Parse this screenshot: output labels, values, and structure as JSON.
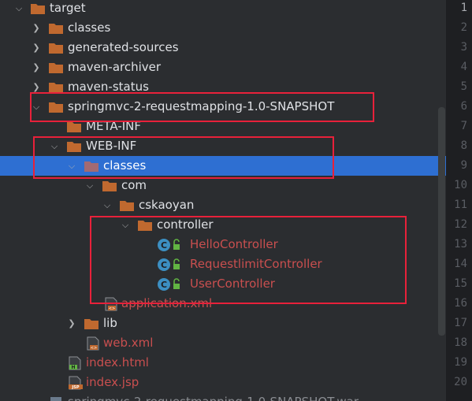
{
  "tree": {
    "items": [
      {
        "label": "target",
        "type": "folder",
        "expanded": true,
        "depth": 0
      },
      {
        "label": "classes",
        "type": "folder",
        "expanded": false,
        "depth": 1
      },
      {
        "label": "generated-sources",
        "type": "folder",
        "expanded": false,
        "depth": 1
      },
      {
        "label": "maven-archiver",
        "type": "folder",
        "expanded": false,
        "depth": 1
      },
      {
        "label": "maven-status",
        "type": "folder",
        "expanded": false,
        "depth": 1
      },
      {
        "label": "springmvc-2-requestmapping-1.0-SNAPSHOT",
        "type": "folder",
        "expanded": true,
        "depth": 1
      },
      {
        "label": "META-INF",
        "type": "folder",
        "expanded": null,
        "depth": 2
      },
      {
        "label": "WEB-INF",
        "type": "folder",
        "expanded": true,
        "depth": 2
      },
      {
        "label": "classes",
        "type": "folder",
        "expanded": true,
        "depth": 3,
        "selected": true
      },
      {
        "label": "com",
        "type": "folder",
        "expanded": true,
        "depth": 4
      },
      {
        "label": "cskaoyan",
        "type": "folder",
        "expanded": true,
        "depth": 5
      },
      {
        "label": "controller",
        "type": "folder",
        "expanded": true,
        "depth": 6
      },
      {
        "label": "HelloController",
        "type": "class",
        "depth": 7
      },
      {
        "label": "RequestlimitController",
        "type": "class",
        "depth": 7
      },
      {
        "label": "UserController",
        "type": "class",
        "depth": 7
      },
      {
        "label": "application.xml",
        "type": "xml",
        "depth": 4
      },
      {
        "label": "lib",
        "type": "folder",
        "expanded": false,
        "depth": 3
      },
      {
        "label": "web.xml",
        "type": "xml",
        "depth": 3
      },
      {
        "label": "index.html",
        "type": "html",
        "depth": 2
      },
      {
        "label": "index.jsp",
        "type": "jsp",
        "depth": 2
      },
      {
        "label": "springmvc-2-requestmapping-1.0-SNAPSHOT.war",
        "type": "war",
        "depth": 1
      }
    ]
  },
  "gutter": {
    "line_numbers": [
      "1",
      "2",
      "3",
      "4",
      "5",
      "6",
      "7",
      "8",
      "9",
      "10",
      "11",
      "12",
      "13",
      "14",
      "15",
      "16",
      "17",
      "18",
      "19",
      "20"
    ]
  },
  "colors": {
    "background": "#2b2d30",
    "selection": "#2e6fd2",
    "folder": "#c0692f",
    "modified_text": "#c94f4f",
    "highlight_box": "#e8213a",
    "class_icon": "#3c8fc2"
  },
  "icons": {
    "folder": "folder-icon",
    "class": "java-class-icon",
    "xml": "xml-file-icon",
    "html": "html-file-icon",
    "jsp": "jsp-file-icon",
    "war": "archive-icon"
  }
}
